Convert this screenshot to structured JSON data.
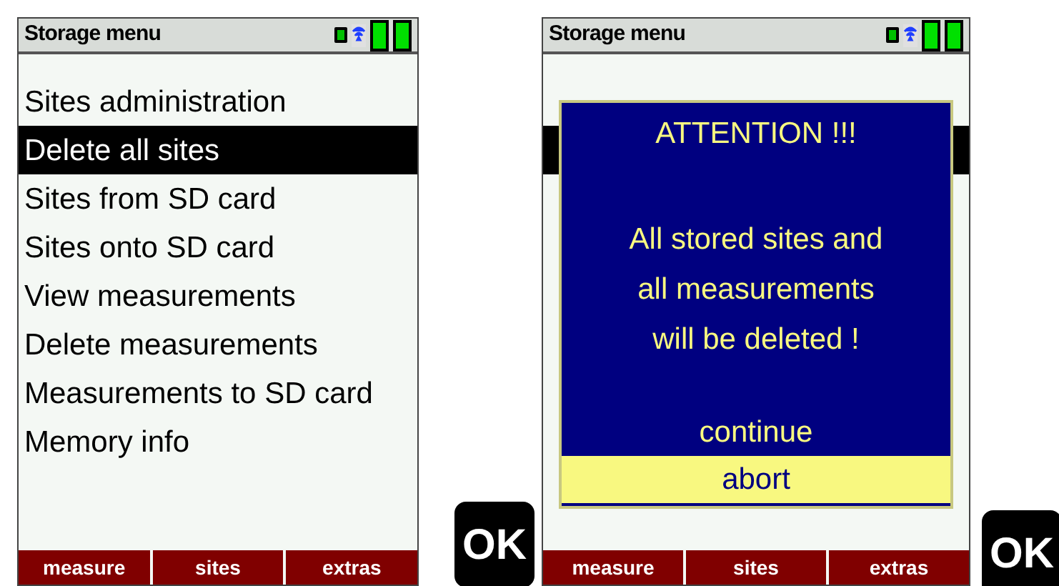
{
  "screens": [
    {
      "title": "Storage menu",
      "menu": [
        {
          "label": "Sites administration",
          "selected": false
        },
        {
          "label": "Delete all sites",
          "selected": true
        },
        {
          "label": "Sites from SD card",
          "selected": false
        },
        {
          "label": "Sites onto SD card",
          "selected": false
        },
        {
          "label": "View measurements",
          "selected": false
        },
        {
          "label": "Delete measurements",
          "selected": false
        },
        {
          "label": "Measurements to SD card",
          "selected": false
        },
        {
          "label": "Memory info",
          "selected": false
        }
      ],
      "softkeys": [
        "measure",
        "sites",
        "extras"
      ],
      "ok": "OK"
    },
    {
      "title": "Storage menu",
      "menu": [
        {
          "selected": false
        },
        {
          "selected": true
        },
        {
          "selected": false
        },
        {
          "selected": false
        },
        {
          "selected": false
        },
        {
          "selected": false
        },
        {
          "selected": false
        },
        {
          "selected": false
        }
      ],
      "softkeys": [
        "measure",
        "sites",
        "extras"
      ],
      "ok": "OK",
      "dialog": {
        "title": "ATTENTION !!!",
        "message": "All stored sites and\nall measurements\nwill be deleted !",
        "options": [
          {
            "label": "continue",
            "selected": false
          },
          {
            "label": "abort",
            "selected": true
          }
        ]
      }
    }
  ]
}
